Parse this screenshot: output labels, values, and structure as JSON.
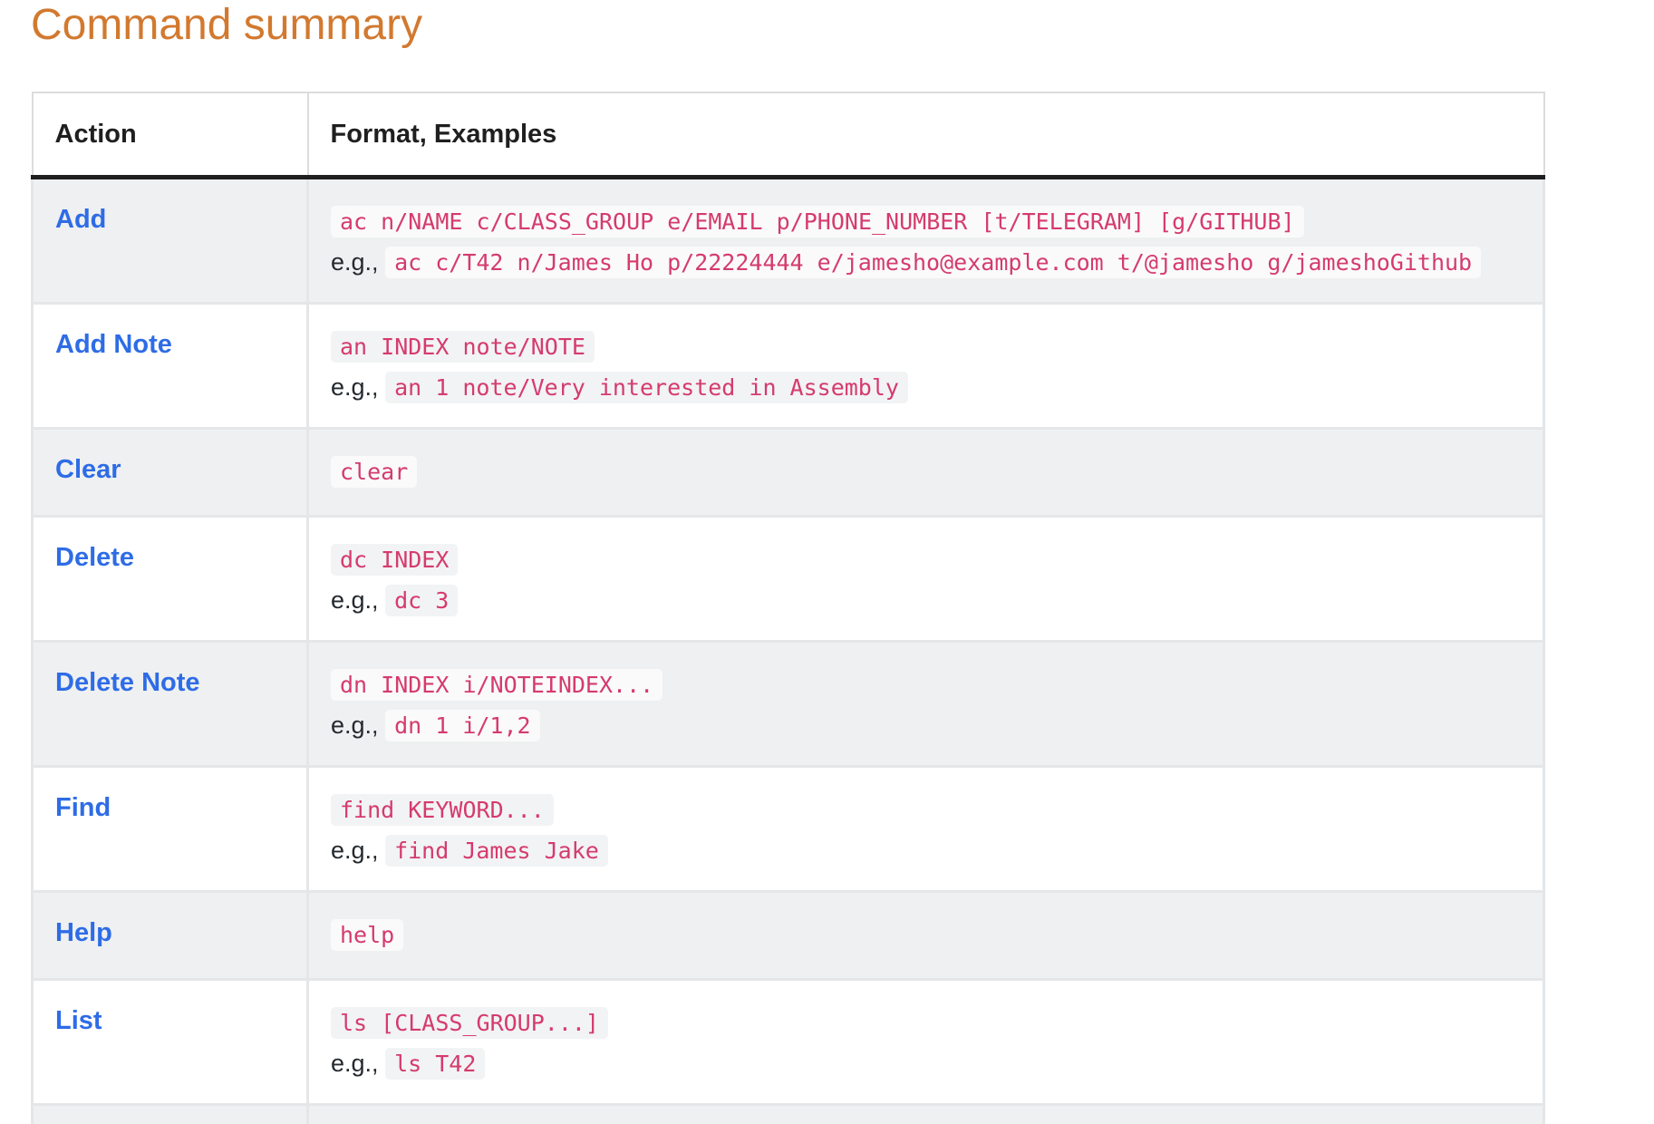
{
  "page": {
    "title": "Command summary"
  },
  "table": {
    "headers": [
      "Action",
      "Format, Examples"
    ],
    "example_prefix": "e.g.,",
    "rows": [
      {
        "action": "Add",
        "format": "ac n/NAME c/CLASS_GROUP e/EMAIL p/PHONE_NUMBER [t/TELEGRAM] [g/GITHUB]",
        "example": "ac c/T42 n/James Ho p/22224444 e/jamesho@example.com t/@jamesho g/jameshoGithub"
      },
      {
        "action": "Add Note",
        "format": "an INDEX note/NOTE",
        "example": "an 1 note/Very interested in Assembly"
      },
      {
        "action": "Clear",
        "format": "clear",
        "example": ""
      },
      {
        "action": "Delete",
        "format": "dc INDEX",
        "example": "dc 3"
      },
      {
        "action": "Delete Note",
        "format": "dn INDEX i/NOTEINDEX...",
        "example": "dn 1 i/1,2"
      },
      {
        "action": "Find",
        "format": "find KEYWORD...",
        "example": "find James Jake"
      },
      {
        "action": "Help",
        "format": "help",
        "example": ""
      },
      {
        "action": "List",
        "format": "ls [CLASS_GROUP...]",
        "example": "ls T42"
      }
    ]
  },
  "colors": {
    "title": "#d2792f",
    "action_link": "#2e6ce6",
    "code_text": "#d53b6d",
    "row_alt": "#eff0f1"
  }
}
